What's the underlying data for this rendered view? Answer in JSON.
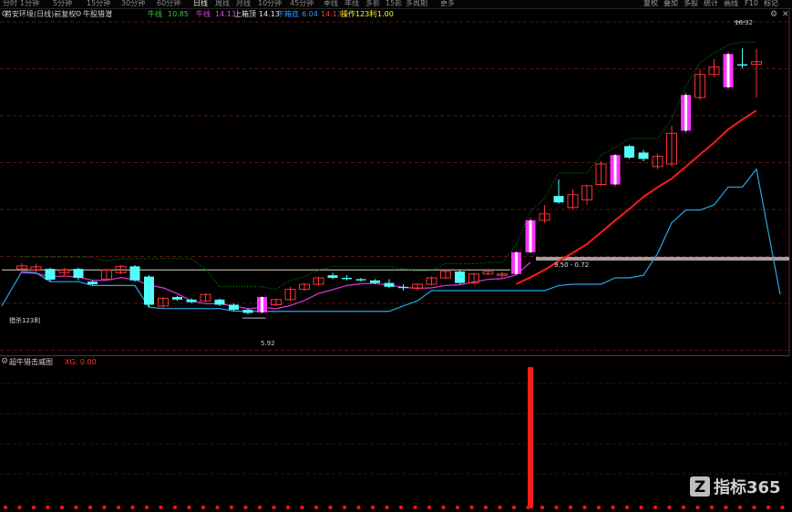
{
  "toolbar": {
    "periods": [
      "分时",
      "1分钟",
      "5分钟",
      "15分钟",
      "30分钟",
      "60分钟",
      "日线",
      "周线",
      "月线",
      "10分钟",
      "45分钟",
      "季线",
      "年线",
      "多影",
      "15影",
      "多周期",
      "更多"
    ],
    "active_period": "日线",
    "right": [
      "复权",
      "叠加",
      "多股",
      "统计",
      "画线",
      "F10",
      "标记"
    ]
  },
  "main_panel": {
    "title": "首安环境(日线)前复权",
    "indicator": "牛股猎潜",
    "legend": [
      {
        "label": "牛线",
        "value": "10.85",
        "color": "#33cc33"
      },
      {
        "label": "牛线",
        "value": "14.13",
        "color": "#dd44dd"
      },
      {
        "label": "上箱顶",
        "value": "14.13",
        "color": "#e8e8e8"
      },
      {
        "label": "下箱底",
        "value": "6.04",
        "color": "#3399ff"
      },
      {
        "label": "",
        "value": "14.13",
        "color": "#ff3333"
      },
      {
        "label": "操作123利",
        "value": "1.00",
        "color": "#ffff33"
      }
    ],
    "box_label": "猎杀123利",
    "high_label": "16.32",
    "low_label": "5.92",
    "range_label": "9.50 - 0.72"
  },
  "sub_panel": {
    "title": "超牛猎击威图",
    "legend": "XG: 0.00"
  },
  "watermark": {
    "icon": "Z",
    "text": "指标365"
  },
  "colors": {
    "up": "#ff3232",
    "down": "#54fcfc",
    "signal": "#ff33ff",
    "green_line": "#00a000",
    "magenta_line": "#cc33cc",
    "red_line": "#ff1a1a",
    "blue_line": "#2aa6e6"
  },
  "chart_data": {
    "type": "candlestick",
    "ylim": [
      4.5,
      17.5
    ],
    "candles": [
      [
        7.82,
        7.92,
        7.6,
        7.7,
        "u"
      ],
      [
        7.78,
        7.9,
        7.55,
        7.65,
        "u"
      ],
      [
        7.7,
        7.75,
        7.2,
        7.28,
        "d"
      ],
      [
        7.55,
        7.75,
        7.45,
        7.65,
        "u"
      ],
      [
        7.7,
        7.75,
        7.25,
        7.35,
        "d"
      ],
      [
        7.2,
        7.25,
        7.05,
        7.1,
        "d"
      ],
      [
        7.3,
        7.7,
        7.25,
        7.65,
        "u"
      ],
      [
        7.55,
        7.85,
        7.5,
        7.8,
        "u"
      ],
      [
        7.8,
        7.85,
        7.2,
        7.25,
        "d"
      ],
      [
        7.4,
        7.45,
        6.2,
        6.3,
        "d"
      ],
      [
        6.25,
        6.6,
        6.15,
        6.55,
        "u"
      ],
      [
        6.6,
        6.65,
        6.45,
        6.5,
        "d"
      ],
      [
        6.5,
        6.55,
        6.35,
        6.4,
        "d"
      ],
      [
        6.45,
        6.75,
        6.4,
        6.7,
        "u"
      ],
      [
        6.5,
        6.55,
        6.25,
        6.3,
        "d"
      ],
      [
        6.3,
        6.35,
        6.05,
        6.1,
        "d"
      ],
      [
        6.1,
        6.15,
        5.92,
        5.98,
        "d"
      ],
      [
        6.0,
        6.65,
        5.95,
        6.6,
        "s"
      ],
      [
        6.3,
        6.55,
        6.25,
        6.5,
        "u"
      ],
      [
        6.5,
        7.0,
        6.45,
        6.9,
        "u"
      ],
      [
        6.9,
        7.15,
        6.85,
        7.1,
        "u"
      ],
      [
        7.1,
        7.4,
        7.05,
        7.35,
        "u"
      ],
      [
        7.45,
        7.55,
        7.3,
        7.35,
        "d"
      ],
      [
        7.35,
        7.45,
        7.25,
        7.3,
        "d"
      ],
      [
        7.3,
        7.35,
        7.2,
        7.25,
        "d"
      ],
      [
        7.25,
        7.3,
        7.1,
        7.15,
        "d"
      ],
      [
        7.15,
        7.3,
        6.95,
        7.0,
        "d"
      ],
      [
        7.0,
        7.1,
        6.85,
        6.95,
        "d"
      ],
      [
        6.95,
        7.15,
        6.85,
        7.1,
        "u"
      ],
      [
        7.1,
        7.4,
        7.05,
        7.35,
        "u"
      ],
      [
        7.35,
        7.65,
        7.3,
        7.6,
        "u"
      ],
      [
        7.6,
        7.65,
        7.1,
        7.15,
        "d"
      ],
      [
        7.15,
        7.55,
        7.1,
        7.5,
        "u"
      ],
      [
        7.5,
        7.7,
        7.45,
        7.6,
        "u"
      ],
      [
        7.45,
        7.6,
        7.35,
        7.5,
        "u"
      ],
      [
        7.5,
        8.4,
        7.45,
        8.35,
        "s"
      ],
      [
        8.35,
        9.7,
        8.3,
        9.6,
        "s"
      ],
      [
        9.6,
        10.2,
        9.5,
        9.85,
        "u"
      ],
      [
        10.3,
        11.2,
        10.25,
        10.55,
        "d"
      ],
      [
        10.1,
        10.8,
        10.0,
        10.6,
        "u"
      ],
      [
        10.4,
        11.0,
        10.2,
        10.95,
        "u"
      ],
      [
        11.0,
        11.9,
        10.95,
        11.8,
        "u"
      ],
      [
        11.0,
        12.2,
        10.9,
        12.15,
        "s"
      ],
      [
        12.5,
        12.55,
        12.0,
        12.05,
        "d"
      ],
      [
        12.0,
        12.35,
        11.9,
        12.25,
        "d"
      ],
      [
        11.7,
        12.2,
        11.6,
        12.1,
        "u"
      ],
      [
        11.8,
        13.3,
        11.7,
        13.0,
        "u"
      ],
      [
        13.1,
        14.6,
        13.0,
        14.5,
        "s"
      ],
      [
        14.4,
        15.5,
        14.3,
        15.3,
        "u"
      ],
      [
        15.6,
        15.9,
        15.2,
        15.3,
        "u"
      ],
      [
        14.8,
        16.2,
        14.7,
        16.1,
        "s"
      ],
      [
        15.7,
        16.32,
        15.55,
        15.65,
        "d"
      ],
      [
        15.8,
        16.3,
        14.4,
        15.7,
        "u"
      ]
    ],
    "box_top": 7.66,
    "box_bottom": 6.04,
    "sub_ylim": [
      0,
      1
    ],
    "signal_index": 36
  }
}
